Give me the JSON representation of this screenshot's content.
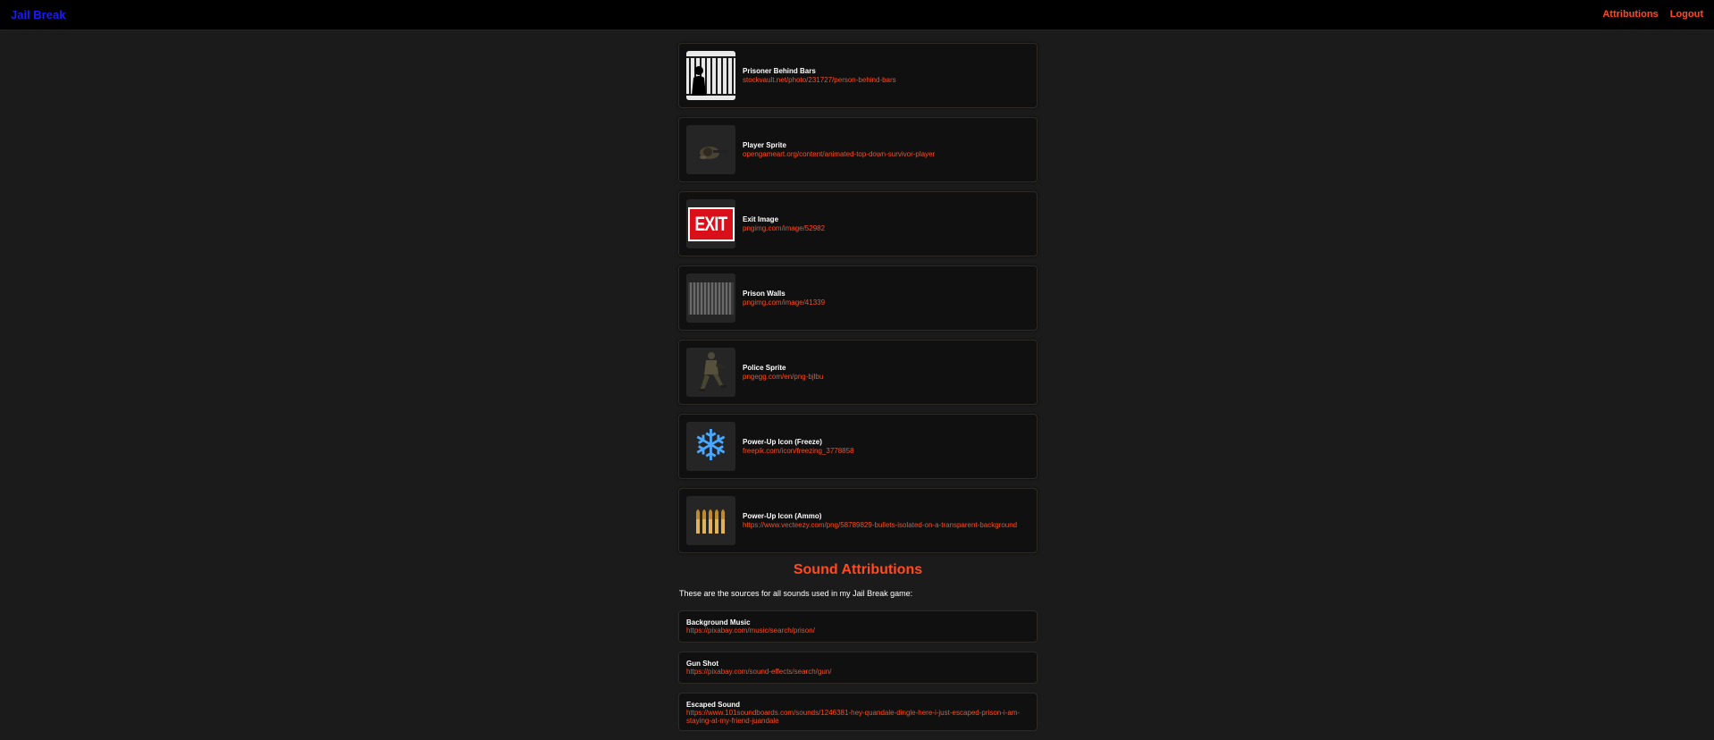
{
  "header": {
    "brand": "Jail Break",
    "nav": [
      {
        "label": "Attributions"
      },
      {
        "label": "Logout"
      }
    ]
  },
  "colors": {
    "accent": "#ff4b1f",
    "brand": "#1a1aff",
    "background": "#1b1b1b",
    "card": "#101010"
  },
  "images": [
    {
      "title": "Prisoner Behind Bars",
      "link": "stockvault.net/photo/231727/person-behind-bars",
      "icon": "prisoner-bars-image"
    },
    {
      "title": "Player Sprite",
      "link": "opengameart.org/content/animated-top-down-survivor-player",
      "icon": "player-sprite-image"
    },
    {
      "title": "Exit Image",
      "link": "pngimg.com/image/52982",
      "icon": "exit-sign-image",
      "icon_text": "EXIT"
    },
    {
      "title": "Prison Walls",
      "link": "pngimg.com/image/41339",
      "icon": "prison-walls-image"
    },
    {
      "title": "Police Sprite",
      "link": "pngegg.com/en/png-bjlbu",
      "icon": "police-sprite-image"
    },
    {
      "title": "Power-Up Icon (Freeze)",
      "link": "freepik.com/icon/freezing_3778858",
      "icon": "snowflake-icon",
      "icon_text": "❄"
    },
    {
      "title": "Power-Up Icon (Ammo)",
      "link": "https://www.vecteezy.com/png/58789829-bullets-isolated-on-a-transparent-background",
      "icon": "bullets-image"
    }
  ],
  "sounds_section": {
    "title": "Sound Attributions",
    "description": "These are the sources for all sounds used in my Jail Break game:"
  },
  "sounds": [
    {
      "title": "Background Music",
      "link": "https://pixabay.com/music/search/prison/"
    },
    {
      "title": "Gun Shot",
      "link": "https://pixabay.com/sound-effects/search/gun/"
    },
    {
      "title": "Escaped Sound",
      "link": "https://www.101soundboards.com/sounds/1246381-hey-quandale-dingle-here-i-just-escaped-prison-i-am-staying-at-my-friend-juandale"
    }
  ]
}
